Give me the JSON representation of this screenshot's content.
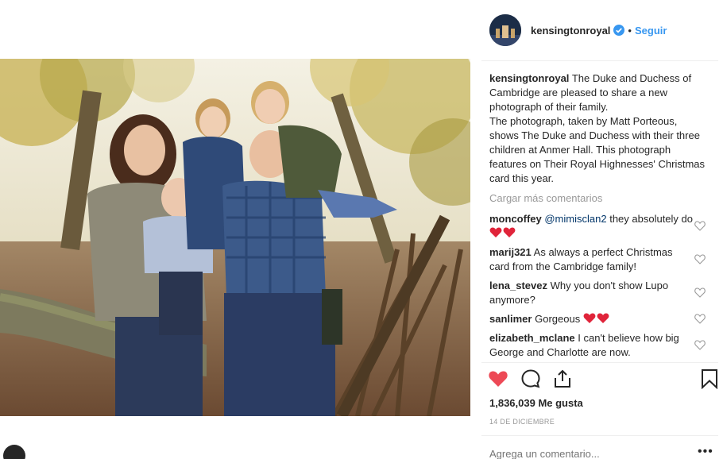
{
  "header": {
    "username": "kensingtonroyal",
    "separator": "•",
    "follow_label": "Seguir",
    "verified_icon": "verified-badge-icon"
  },
  "caption": {
    "username": "kensingtonroyal",
    "text": "The Duke and Duchess of Cambridge are pleased to share a new photograph of their family.",
    "text2": "The photograph, taken by Matt Porteous, shows The Duke and Duchess with their three children at Anmer Hall. This photograph features on Their Royal Highnesses' Christmas card this year."
  },
  "load_more_label": "Cargar más comentarios",
  "comments": [
    {
      "username": "moncoffey",
      "mention": "@mimisclan2",
      "text": "they absolutely do",
      "hearts": 2
    },
    {
      "username": "marij321",
      "text": "As always a perfect Christmas card from the Cambridge family!"
    },
    {
      "username": "lena_stevez",
      "text": "Why you don't show Lupo anymore?"
    },
    {
      "username": "sanlimer",
      "text": "Gorgeous",
      "hearts": 2
    },
    {
      "username": "elizabeth_mclane",
      "text": "I can't believe how big George and Charlotte are now."
    }
  ],
  "actions": {
    "like_icon": "heart-filled-icon",
    "comment_icon": "comment-bubble-icon",
    "share_icon": "share-upload-icon",
    "save_icon": "bookmark-icon"
  },
  "likes_label": "1,836,039 Me gusta",
  "date_label": "14 DE DICIEMBRE",
  "add_comment_placeholder": "Agrega un comentario...",
  "more_label": "•••",
  "colors": {
    "accent": "#3897f0",
    "heart": "#ed4956",
    "muted": "#999999",
    "mention": "#003569"
  }
}
